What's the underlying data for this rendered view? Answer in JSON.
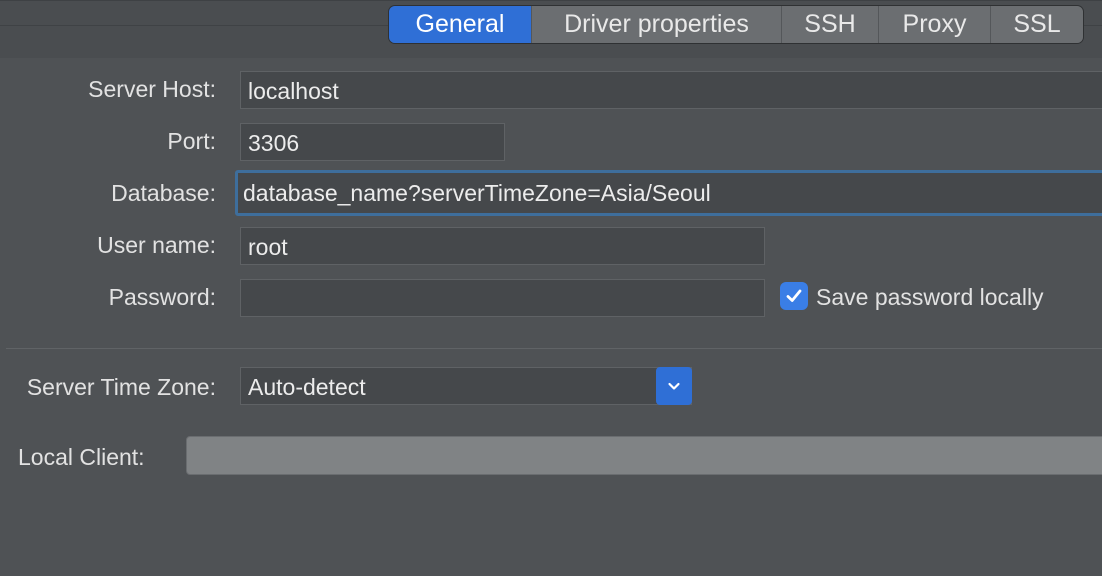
{
  "tabs": [
    {
      "label": "General",
      "active": true
    },
    {
      "label": "Driver properties",
      "active": false
    },
    {
      "label": "SSH",
      "active": false
    },
    {
      "label": "Proxy",
      "active": false
    },
    {
      "label": "SSL",
      "active": false
    }
  ],
  "form": {
    "server_host": {
      "label": "Server Host:",
      "value": "localhost"
    },
    "port": {
      "label": "Port:",
      "value": "3306"
    },
    "database": {
      "label": "Database:",
      "value": "database_name?serverTimeZone=Asia/Seoul"
    },
    "user_name": {
      "label": "User name:",
      "value": "root"
    },
    "password": {
      "label": "Password:",
      "value": ""
    },
    "save_password": {
      "label": "Save password locally",
      "checked": true
    },
    "server_time_zone": {
      "label": "Server Time Zone:",
      "selected": "Auto-detect"
    },
    "local_client": {
      "label": "Local Client:",
      "value": ""
    }
  },
  "colors": {
    "accent": "#2f6fd6",
    "background": "#4f5255",
    "field_bg": "#45484b",
    "focus_border": "#3e6e9c"
  },
  "icons": {
    "checkbox": "checkmark-icon",
    "dropdown": "chevron-down-icon"
  }
}
